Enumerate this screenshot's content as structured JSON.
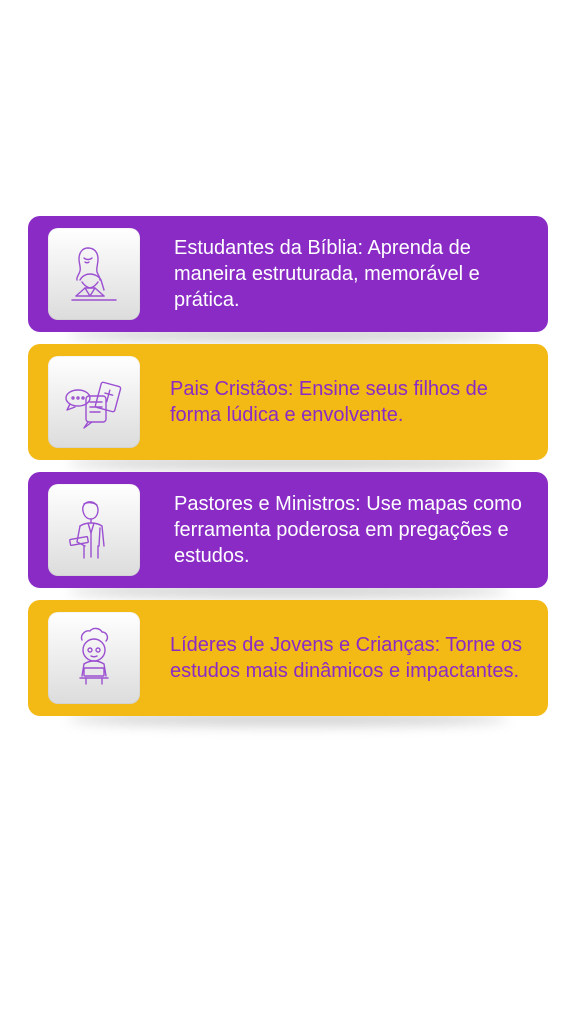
{
  "colors": {
    "purple": "#8a2bc6",
    "yellow": "#f3b914",
    "icon_stroke": "#9b4fd1"
  },
  "cards": [
    {
      "icon": "woman-reading-bible-icon",
      "text": "Estudantes da Bíblia: Aprenda de maneira estruturada, memorável e prática."
    },
    {
      "icon": "chat-bubbles-bible-icon",
      "text": "Pais Cristãos: Ensine seus filhos de forma lúdica e envolvente."
    },
    {
      "icon": "pastor-holding-bible-icon",
      "text": "Pastores e Ministros: Use mapas como ferramenta poderosa em pregações e estudos."
    },
    {
      "icon": "child-with-book-icon",
      "text": "Líderes de Jovens e Crianças: Torne os estudos mais dinâmicos e impactantes."
    }
  ]
}
